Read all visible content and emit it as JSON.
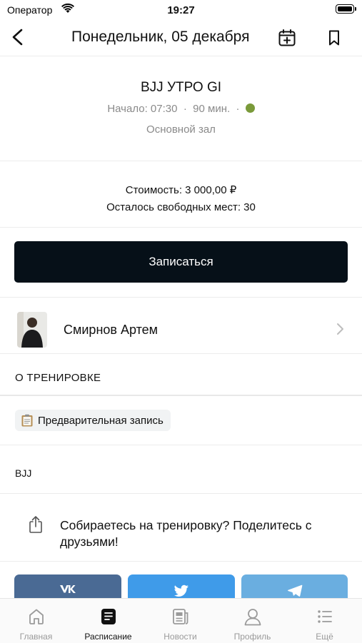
{
  "status_bar": {
    "carrier": "Оператор",
    "time": "19:27"
  },
  "header": {
    "title": "Понедельник, 05 декабря"
  },
  "event": {
    "title": "BJJ УТРО GI",
    "start": "Начало: 07:30",
    "duration": "90 мин.",
    "separator": "·",
    "status_color": "#7a9a3a",
    "hall": "Основной зал",
    "price": "Стоимость: 3 000,00 ₽",
    "seats": "Осталось свободных мест: 30",
    "signup_label": "Записаться"
  },
  "coach": {
    "name": "Смирнов Артем"
  },
  "about": {
    "heading": "О ТРЕНИРОВКЕ",
    "tag": "Предварительная запись",
    "type": "BJJ"
  },
  "share": {
    "text": "Собираетесь на тренировку? Поделитесь с друзьями!",
    "buttons": [
      {
        "network": "vk",
        "icon": "vk-icon",
        "color": "#4a6a94"
      },
      {
        "network": "twitter",
        "icon": "twitter-icon",
        "color": "#3f9be9"
      },
      {
        "network": "telegram",
        "icon": "telegram-icon",
        "color": "#6aaee0"
      }
    ]
  },
  "tabbar": {
    "active": "Расписание",
    "items": [
      {
        "label": "Главная",
        "icon": "home-icon"
      },
      {
        "label": "Расписание",
        "icon": "schedule-icon"
      },
      {
        "label": "Новости",
        "icon": "news-icon"
      },
      {
        "label": "Профиль",
        "icon": "profile-icon"
      },
      {
        "label": "Ещё",
        "icon": "more-icon"
      }
    ]
  }
}
